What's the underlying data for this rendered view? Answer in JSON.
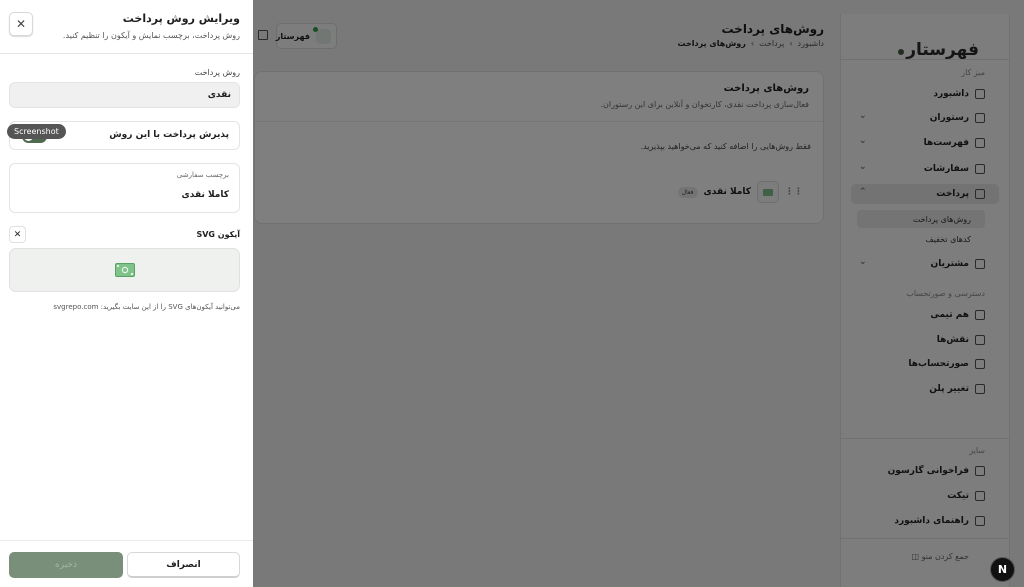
{
  "app": {
    "logo": "فهرستار",
    "header": {
      "title": "روش‌های پرداخت",
      "breadcrumb": [
        "داشبورد",
        "پرداخت",
        "روش‌های پرداخت"
      ]
    },
    "restaurant_chip": "فهرستار",
    "sidebar": {
      "section_main": "میز کار",
      "items": [
        {
          "label": "داشبورد",
          "icon": "grid-icon"
        },
        {
          "label": "رستوران",
          "icon": "store-icon"
        },
        {
          "label": "فهرست‌ها",
          "icon": "utensils-icon"
        },
        {
          "label": "سفارشات",
          "icon": "bag-icon"
        },
        {
          "label": "پرداخت",
          "icon": "tag-icon"
        },
        {
          "label": "مشتریان",
          "icon": "contacts-icon"
        }
      ],
      "payment_sub": [
        "روش‌های پرداخت",
        "کدهای تخفیف"
      ],
      "section_access": "دسترسی و صورتحساب",
      "access_items": [
        {
          "label": "هم تیمی",
          "icon": "users-icon"
        },
        {
          "label": "نقش‌ها",
          "icon": "shield-icon"
        },
        {
          "label": "صورتحساب‌ها",
          "icon": "receipt-icon"
        },
        {
          "label": "تغییر پلن",
          "icon": "crown-icon"
        }
      ],
      "section_other": "سایر",
      "other_items": [
        {
          "label": "فراخوانی گارسون",
          "icon": "bell-icon"
        },
        {
          "label": "تیکت",
          "icon": "ticket-icon"
        },
        {
          "label": "راهنمای داشبورد",
          "icon": "help-icon"
        }
      ],
      "collapse": "جمع کردن منو"
    },
    "card": {
      "title": "روش‌های پرداخت",
      "description": "فعال‌سازی پرداخت نقدی، کارتخوان و آنلاین برای این رستوران.",
      "hint": "فقط روش‌هایی را اضافه کنید که می‌خواهید بپذیرید.",
      "method": {
        "name": "کاملا نقدی",
        "badge": "فعال"
      }
    }
  },
  "drawer": {
    "title": "ویرایش روش پرداخت",
    "subtitle": "روش پرداخت، برچسب نمایش و آیکون را تنظیم کنید.",
    "method_label": "روش پرداخت",
    "method_value": "نقدی",
    "accept_label": "پذیرش پرداخت با این روش",
    "accept_on": true,
    "tooltip": "Screenshot",
    "custom_label": "برچسب سفارشی",
    "custom_value": "کاملا نقدی",
    "svg_label": "آیکون SVG",
    "svg_hint": "می‌توانید آیکون‌های SVG را از این سایت بگیرید: svgrepo.com",
    "save": "ذخیره",
    "cancel": "انصراف"
  },
  "floating_badge": "N"
}
